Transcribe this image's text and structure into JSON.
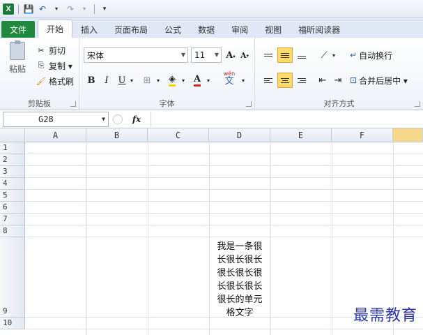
{
  "titlebar": {
    "app_logo": "X",
    "qa_save": "💾",
    "qa_undo": "↶",
    "qa_redo": "↷",
    "qa_customize": "▾"
  },
  "tabs": [
    {
      "label": "文件"
    },
    {
      "label": "开始"
    },
    {
      "label": "插入"
    },
    {
      "label": "页面布局"
    },
    {
      "label": "公式"
    },
    {
      "label": "数据"
    },
    {
      "label": "审阅"
    },
    {
      "label": "视图"
    },
    {
      "label": "福昕阅读器"
    }
  ],
  "ribbon": {
    "clipboard": {
      "paste": "粘贴",
      "cut": "剪切",
      "copy": "复制 ▾",
      "format_painter": "格式刷",
      "label": "剪贴板"
    },
    "font": {
      "name": "宋体",
      "size": "11",
      "grow": "A",
      "shrink": "A",
      "bold": "B",
      "italic": "I",
      "underline": "U",
      "phonetic": "wén",
      "label": "字体"
    },
    "alignment": {
      "wrap_text": "自动换行",
      "merge_center": "合并后居中 ▾",
      "label": "对齐方式"
    }
  },
  "formula_bar": {
    "name_box": "G28",
    "fx": "fx",
    "content": ""
  },
  "grid": {
    "columns": [
      "A",
      "B",
      "C",
      "D",
      "E",
      "F",
      ""
    ],
    "rows": [
      "1",
      "2",
      "3",
      "4",
      "5",
      "6",
      "7",
      "8",
      "9",
      "10"
    ],
    "cell_D9": "我是一条很长很长很长很长很长很长很长很长很长的单元格文字"
  },
  "watermark": "最需教育",
  "colors": {
    "file_tab": "#1f8a3e",
    "selected_header": "#f8d98c",
    "active_align": "#ffdb6e",
    "watermark": "#2f3aa6"
  }
}
